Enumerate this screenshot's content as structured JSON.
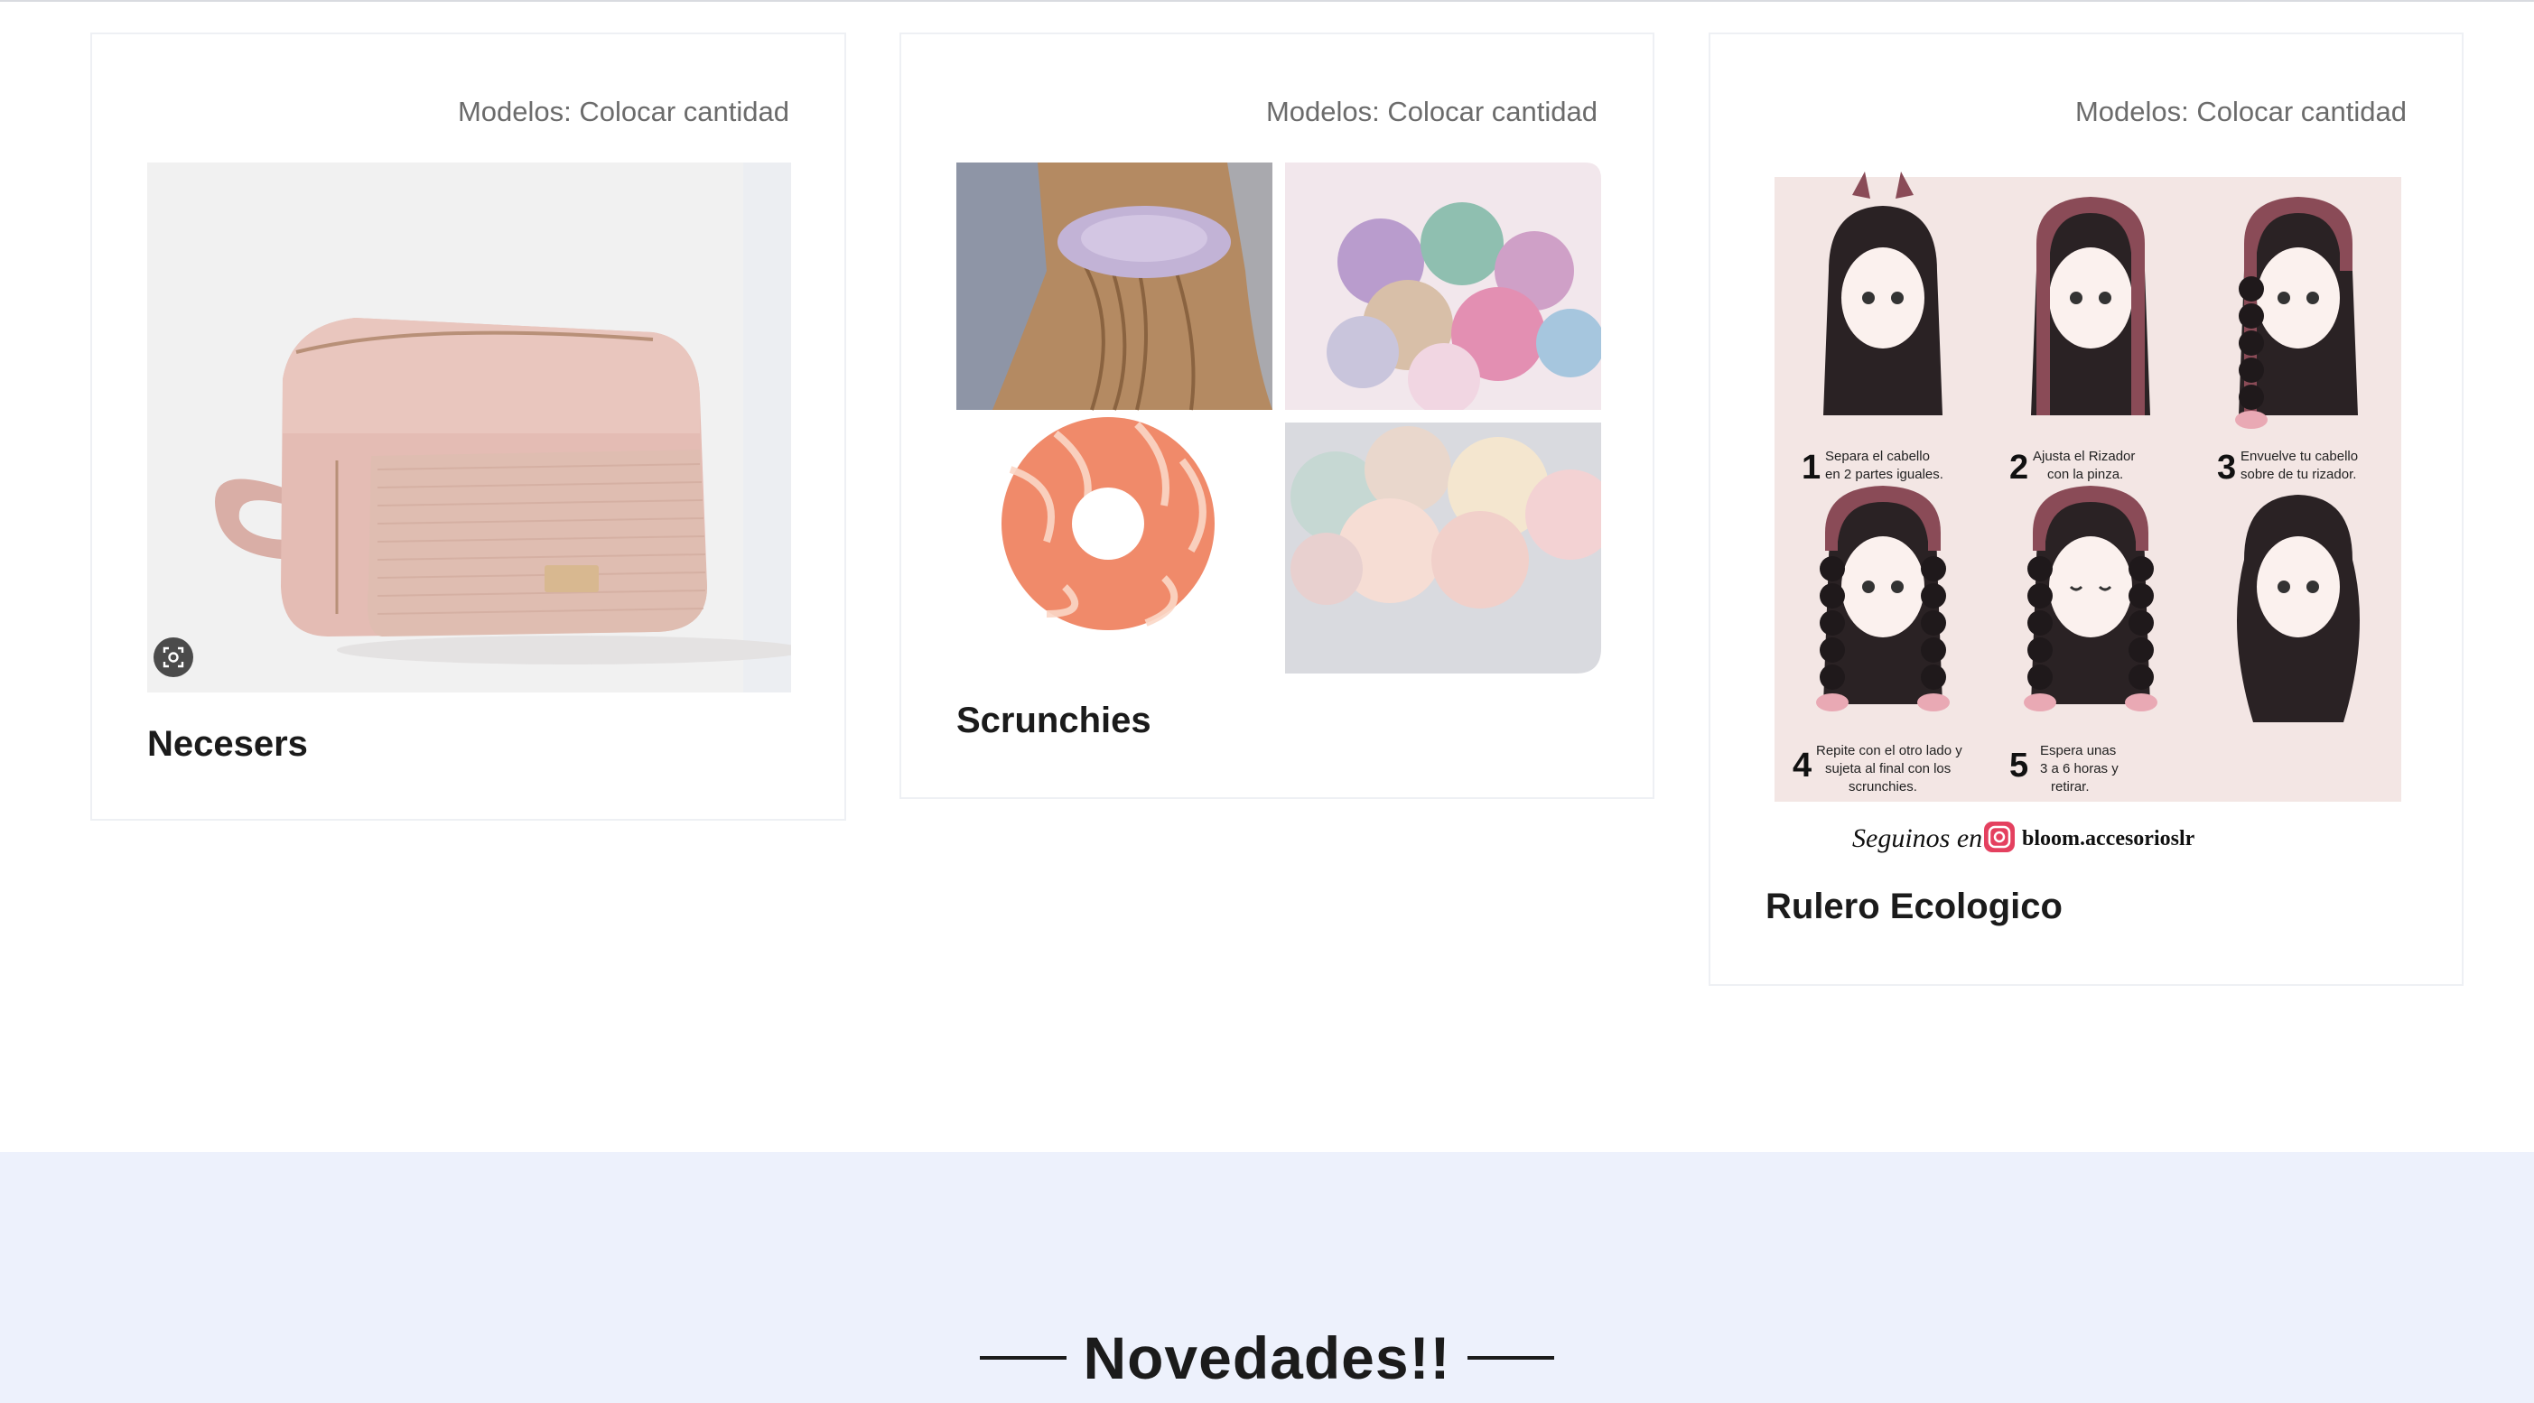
{
  "cards": [
    {
      "models_label": "Modelos: Colocar cantidad",
      "title": "Necesers"
    },
    {
      "models_label": "Modelos: Colocar cantidad",
      "title": "Scrunchies"
    },
    {
      "models_label": "Modelos: Colocar cantidad",
      "title": "Rulero Ecologico"
    }
  ],
  "rulero_image": {
    "steps": [
      {
        "num": "1",
        "line1": "Separa el cabello",
        "line2": "en 2 partes iguales."
      },
      {
        "num": "2",
        "line1": "Ajusta el Rizador",
        "line2": "con la pinza."
      },
      {
        "num": "3",
        "line1": "Envuelve tu cabello",
        "line2": "sobre de tu rizador."
      },
      {
        "num": "4",
        "line1": "Repite con el otro lado y",
        "line2": "sujeta al final con los",
        "line3": "scrunchies."
      },
      {
        "num": "5",
        "line1": "Espera unas",
        "line2": "3 a 6 horas y",
        "line3": "retirar."
      }
    ],
    "follow_text": "Seguinos en",
    "instagram_handle": "bloom.accesorioslr"
  },
  "section": {
    "heading": "Novedades!!"
  },
  "icons": [
    "zoom-icon",
    "instagram-icon"
  ],
  "colors": {
    "card_border": "#eef0f4",
    "band_background": "#edf1fc",
    "text_dark": "#1b1b1b",
    "text_muted": "#6b6b6b"
  }
}
